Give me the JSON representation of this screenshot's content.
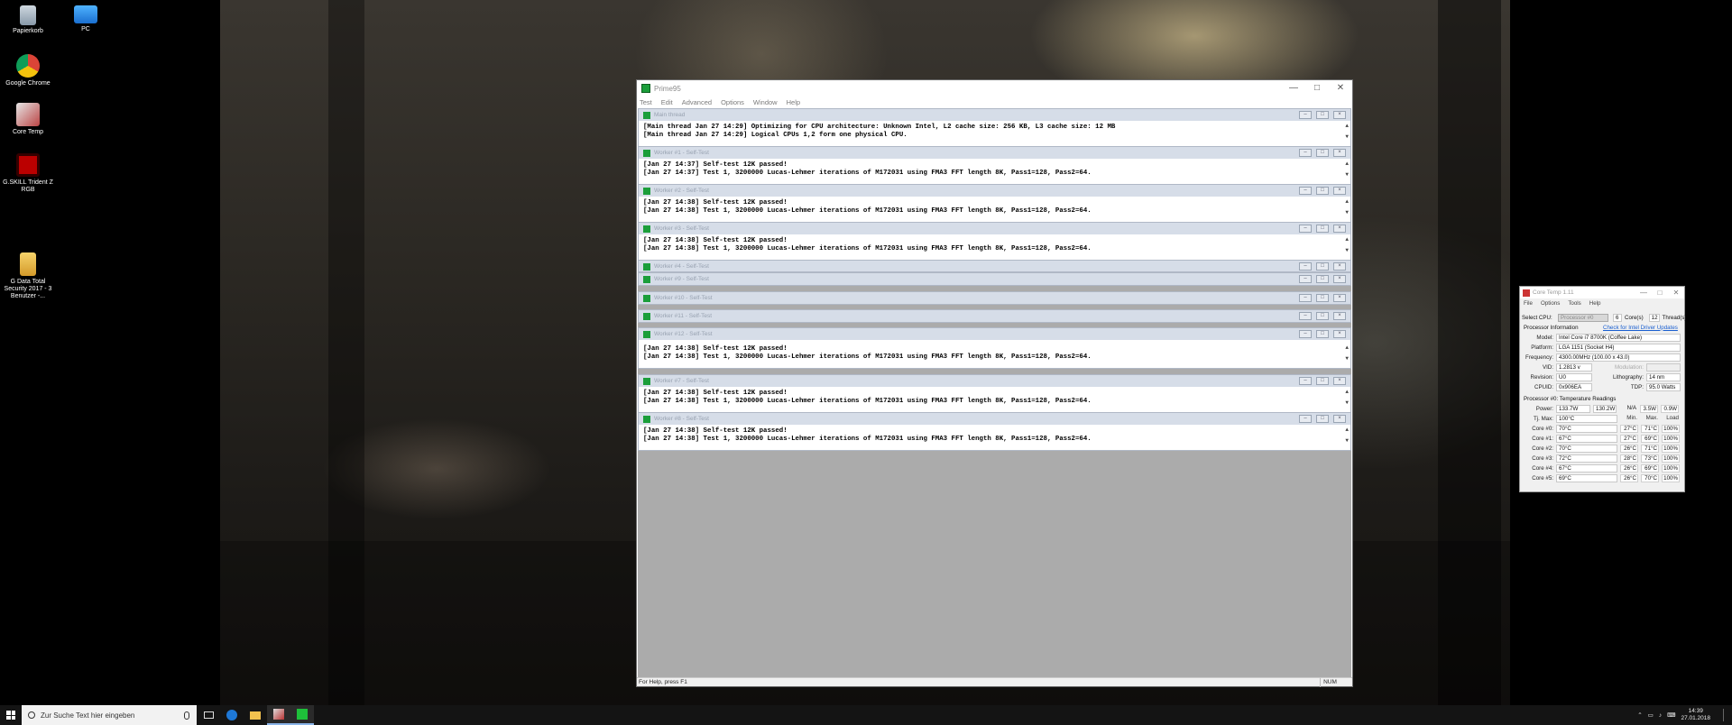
{
  "desktop": {
    "icons": [
      {
        "label": "Papierkorb"
      },
      {
        "label": "PC"
      },
      {
        "label": "Google Chrome"
      },
      {
        "label": "Core Temp"
      },
      {
        "label": "G.SKILL Trident Z RGB"
      },
      {
        "label": "G Data Total Security 2017 - 3 Benutzer -..."
      }
    ]
  },
  "prime95": {
    "title": "Prime95",
    "menu": [
      "Test",
      "Edit",
      "Advanced",
      "Options",
      "Window",
      "Help"
    ],
    "status_help": "For Help, press F1",
    "status_num": "NUM",
    "children": [
      {
        "title": "Main thread",
        "lines": [
          "[Main thread Jan 27 14:29] Optimizing for CPU architecture: Unknown Intel, L2 cache size: 256 KB, L3 cache size: 12 MB",
          "[Main thread Jan 27 14:29] Logical CPUs 1,2 form one physical CPU."
        ]
      },
      {
        "title": "Worker #1 - Self-Test",
        "lines": [
          "[Jan 27 14:37] Self-test 12K passed!",
          "[Jan 27 14:37] Test 1, 3200000 Lucas-Lehmer iterations of M172031 using FMA3 FFT length 8K, Pass1=128, Pass2=64."
        ]
      },
      {
        "title": "Worker #2 - Self-Test",
        "lines": [
          "[Jan 27 14:38] Self-test 12K passed!",
          "[Jan 27 14:38] Test 1, 3200000 Lucas-Lehmer iterations of M172031 using FMA3 FFT length 8K, Pass1=128, Pass2=64."
        ]
      },
      {
        "title": "Worker #3 - Self-Test",
        "lines": [
          "[Jan 27 14:38] Self-test 12K passed!",
          "[Jan 27 14:38] Test 1, 3200000 Lucas-Lehmer iterations of M172031 using FMA3 FFT length 8K, Pass1=128, Pass2=64."
        ]
      },
      {
        "title": "Worker #4 - Self-Test",
        "lines": []
      },
      {
        "title": "Worker #9 - Self-Test",
        "lines": []
      },
      {
        "title": "Worker #10 - Self-Test",
        "lines": []
      },
      {
        "title": "Worker #11 - Self-Test",
        "lines": []
      },
      {
        "title": "Worker #12 - Self-Test",
        "lines": [
          "[Jan 27 14:38] Self-test 12K passed!",
          "[Jan 27 14:38] Test 1, 3200000 Lucas-Lehmer iterations of M172031 using FMA3 FFT length 8K, Pass1=128, Pass2=64."
        ]
      },
      {
        "title": "Worker #7 - Self-Test",
        "lines": [
          "[Jan 27 14:38] Self-test 12K passed!",
          "[Jan 27 14:38] Test 1, 3200000 Lucas-Lehmer iterations of M172031 using FMA3 FFT length 8K, Pass1=128, Pass2=64."
        ]
      },
      {
        "title": "Worker #8 - Self-Test",
        "lines": [
          "[Jan 27 14:38] Self-test 12K passed!",
          "[Jan 27 14:38] Test 1, 3200000 Lucas-Lehmer iterations of M172031 using FMA3 FFT length 8K, Pass1=128, Pass2=64."
        ]
      }
    ]
  },
  "coretemp": {
    "title": "Core Temp 1.11",
    "menu": [
      "File",
      "Options",
      "Tools",
      "Help"
    ],
    "select_cpu_label": "Select CPU:",
    "select_cpu_value": "Processor #0",
    "cores_value": "6",
    "cores_label": "Core(s)",
    "threads_value": "12",
    "threads_label": "Thread(s)",
    "proc_info_label": "Processor Information",
    "driver_link": "Check for Intel Driver Updates",
    "model_label": "Model:",
    "model_value": "Intel Core i7 8700K (Coffee Lake)",
    "platform_label": "Platform:",
    "platform_value": "LGA 1151 (Socket H4)",
    "frequency_label": "Frequency:",
    "frequency_value": "4300.00MHz (100.00 x 43.0)",
    "vid_label": "VID:",
    "vid_value": "1.2813 v",
    "modulation_label": "Modulation:",
    "revision_label": "Revision:",
    "revision_value": "U0",
    "lithography_label": "Lithography:",
    "lithography_value": "14 nm",
    "cpuid_label": "CPUID:",
    "cpuid_value": "0x906EA",
    "tdp_label": "TDP:",
    "tdp_value": "95.0 Watts",
    "readings_label": "Processor #0: Temperature Readings",
    "power_label": "Power:",
    "power_values": [
      "133.7W",
      "130.2W",
      "N/A",
      "3.5W",
      "0.9W"
    ],
    "tjmax_label": "Tj. Max:",
    "tjmax_value": "100°C",
    "col_min": "Min.",
    "col_max": "Max.",
    "col_load": "Load",
    "cores": [
      {
        "label": "Core #0:",
        "temp": "70°C",
        "min": "27°C",
        "max": "71°C",
        "load": "100%"
      },
      {
        "label": "Core #1:",
        "temp": "67°C",
        "min": "27°C",
        "max": "69°C",
        "load": "100%"
      },
      {
        "label": "Core #2:",
        "temp": "70°C",
        "min": "26°C",
        "max": "71°C",
        "load": "100%"
      },
      {
        "label": "Core #3:",
        "temp": "72°C",
        "min": "28°C",
        "max": "73°C",
        "load": "100%"
      },
      {
        "label": "Core #4:",
        "temp": "67°C",
        "min": "26°C",
        "max": "69°C",
        "load": "100%"
      },
      {
        "label": "Core #5:",
        "temp": "69°C",
        "min": "26°C",
        "max": "70°C",
        "load": "100%"
      }
    ]
  },
  "taskbar": {
    "search_placeholder": "Zur Suche Text hier eingeben",
    "time": "14:39",
    "date": "27.01.2018"
  }
}
